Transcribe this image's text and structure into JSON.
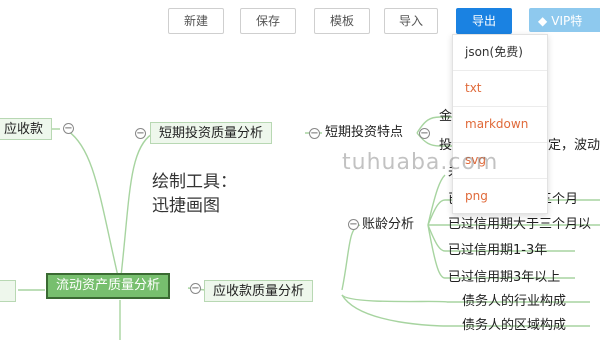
{
  "toolbar": {
    "new_label": "新建",
    "save_label": "保存",
    "template_label": "模板",
    "import_label": "导入",
    "export_label": "导出",
    "vip_label": "VIP特"
  },
  "export_menu": [
    "json(免费)",
    "txt",
    "markdown",
    "svg",
    "png"
  ],
  "mindmap": {
    "left_partial": "应收款",
    "short_term": "短期投资质量分析",
    "short_term_feature": "短期投资特点",
    "cut_1": "金",
    "cut_2": "投",
    "cut_3": "定，波动",
    "central": "流动资产质量分析",
    "receivables": "应收款质量分析",
    "aging": "账龄分析",
    "age_1": "已过信用期大于三个月",
    "age_2": "已过信用期大于三个月以",
    "age_3": "已过信用期1-3年",
    "age_4": "已过信用期3年以上",
    "debtor_industry": "债务人的行业构成",
    "debtor_region": "债务人的区域构成",
    "age_top_partial": "未"
  },
  "caption": {
    "line1": "绘制工具：",
    "line2": "迅捷画图"
  },
  "watermark": "tuhuaba.com",
  "colors": {
    "export_btn": "#1a82e2",
    "vip_btn": "#8ec9ee",
    "central_node": "#77bf6e",
    "branch": "#a7d4a0"
  }
}
